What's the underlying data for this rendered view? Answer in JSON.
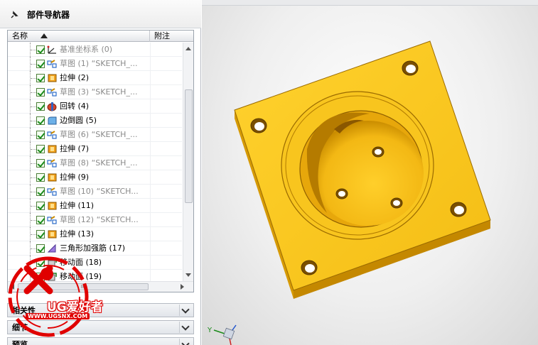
{
  "navigator": {
    "title": "部件导航器",
    "columns": {
      "name": "名称",
      "note": "附注"
    },
    "items": [
      {
        "label": "基准坐标系 (0)",
        "icon": "datum-csys-icon",
        "dim": true
      },
      {
        "label": "草图 (1) “SKETCH_...",
        "icon": "sketch-icon",
        "dim": true
      },
      {
        "label": "拉伸 (2)",
        "icon": "extrude-icon",
        "dim": false
      },
      {
        "label": "草图 (3) “SKETCH_...",
        "icon": "sketch-icon",
        "dim": true
      },
      {
        "label": "回转 (4)",
        "icon": "revolve-icon",
        "dim": false
      },
      {
        "label": "边倒圆 (5)",
        "icon": "edge-blend-icon",
        "dim": false
      },
      {
        "label": "草图 (6) “SKETCH_...",
        "icon": "sketch-icon",
        "dim": true
      },
      {
        "label": "拉伸 (7)",
        "icon": "extrude-icon",
        "dim": false
      },
      {
        "label": "草图 (8) “SKETCH_...",
        "icon": "sketch-icon",
        "dim": true
      },
      {
        "label": "拉伸 (9)",
        "icon": "extrude-icon",
        "dim": false
      },
      {
        "label": "草图 (10) “SKETCH...",
        "icon": "sketch-icon",
        "dim": true
      },
      {
        "label": "拉伸 (11)",
        "icon": "extrude-icon",
        "dim": false
      },
      {
        "label": "草图 (12) “SKETCH...",
        "icon": "sketch-icon",
        "dim": true
      },
      {
        "label": "拉伸 (13)",
        "icon": "extrude-icon",
        "dim": false
      },
      {
        "label": "三角形加强筋 (17)",
        "icon": "rib-icon",
        "dim": false
      },
      {
        "label": "移动面 (18)",
        "icon": "move-face-icon",
        "dim": false
      },
      {
        "label": "移动面 (19)",
        "icon": "move-face-icon",
        "dim": false
      }
    ],
    "hscroll_mark": "III",
    "sections": [
      {
        "label": "相关性"
      },
      {
        "label": "细节"
      },
      {
        "label": "预览"
      }
    ]
  },
  "watermark": {
    "brand": "UG爱好者",
    "url": "WWW.UGSNX.COM"
  },
  "viewport": {
    "triad_label": "Y"
  },
  "colors": {
    "part_face": "#f7c31f",
    "part_side": "#d69a06",
    "part_dark": "#a06c00",
    "check": "#1b8a1b",
    "watermark_red": "#e00000"
  }
}
